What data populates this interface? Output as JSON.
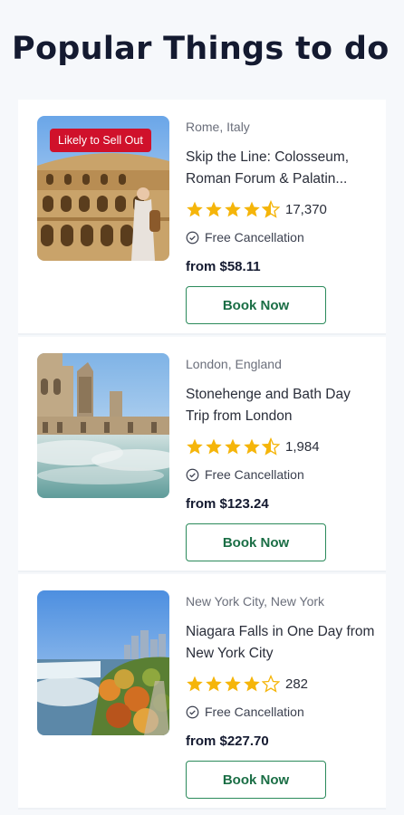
{
  "page": {
    "title": "Popular Things to do"
  },
  "colors": {
    "accent": "#1a6e45",
    "star": "#f5b50a",
    "badge": "#d0112b"
  },
  "tours": [
    {
      "badge": "Likely to Sell Out",
      "location": "Rome, Italy",
      "name": "Skip the Line: Colosseum, Roman Forum & Palatin...",
      "rating": 4.5,
      "review_count": "17,370",
      "cancellation": "Free Cancellation",
      "price": "from $58.11",
      "cta": "Book Now"
    },
    {
      "location": "London, England",
      "name": "Stonehenge and Bath Day Trip from London",
      "rating": 4.5,
      "review_count": "1,984",
      "cancellation": "Free Cancellation",
      "price": "from $123.24",
      "cta": "Book Now"
    },
    {
      "location": "New York City, New York",
      "name": "Niagara Falls in One Day from New York City",
      "rating": 4,
      "review_count": "282",
      "cancellation": "Free Cancellation",
      "price": "from $227.70",
      "cta": "Book Now"
    }
  ]
}
